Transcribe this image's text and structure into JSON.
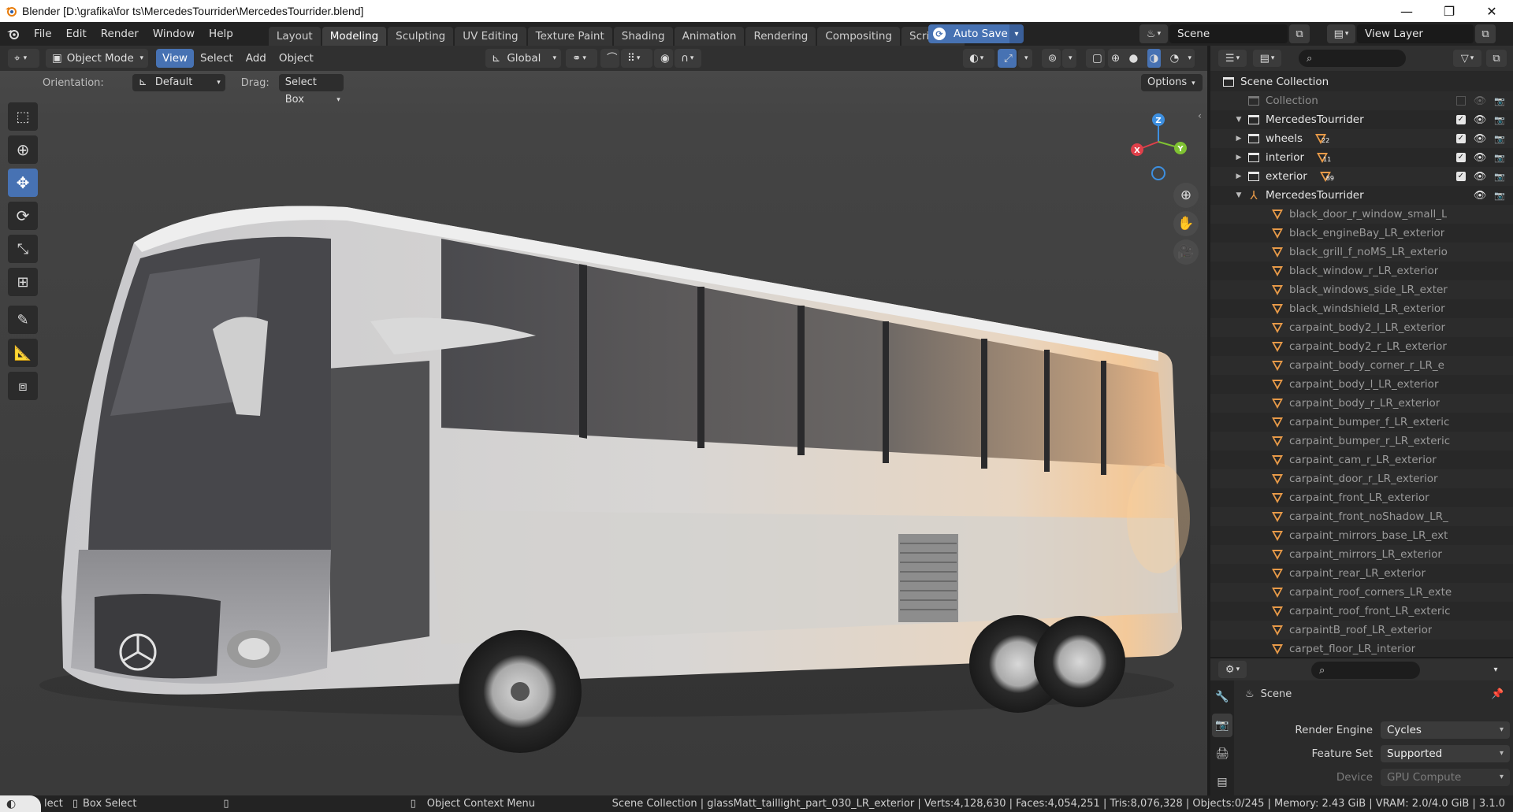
{
  "window": {
    "title": "Blender [D:\\grafika\\for ts\\MercedesTourrider\\MercedesTourrider.blend]",
    "minimize": "—",
    "maximize": "❐",
    "close": "✕"
  },
  "menu": [
    "File",
    "Edit",
    "Render",
    "Window",
    "Help"
  ],
  "workspaces": [
    {
      "label": "Layout",
      "active": false
    },
    {
      "label": "Modeling",
      "active": true
    },
    {
      "label": "Sculpting",
      "active": false
    },
    {
      "label": "UV Editing",
      "active": false
    },
    {
      "label": "Texture Paint",
      "active": false
    },
    {
      "label": "Shading",
      "active": false
    },
    {
      "label": "Animation",
      "active": false
    },
    {
      "label": "Rendering",
      "active": false
    },
    {
      "label": "Compositing",
      "active": false
    },
    {
      "label": "Scripting",
      "active": false
    }
  ],
  "workspace_add": "+",
  "auto_save": "Auto Save",
  "scene_name": "Scene",
  "view_layer": "View Layer",
  "viewport": {
    "mode": "Object Mode",
    "menus": [
      {
        "label": "View",
        "active": true
      },
      {
        "label": "Select",
        "active": false
      },
      {
        "label": "Add",
        "active": false
      },
      {
        "label": "Object",
        "active": false
      }
    ],
    "transform_orientation": "Global",
    "orientation_label": "Orientation:",
    "orientation_value": "Default",
    "drag_label": "Drag:",
    "drag_value": "Select Box",
    "options": "Options",
    "gizmo": {
      "x": "X",
      "y": "Y",
      "z": "Z"
    }
  },
  "outliner": {
    "rows": [
      {
        "label": "Scene Collection",
        "indent": 0,
        "type": "scene",
        "arrow": ""
      },
      {
        "label": "Collection",
        "indent": 1,
        "type": "collection-dim",
        "arrow": ""
      },
      {
        "label": "MercedesTourrider",
        "indent": 1,
        "type": "collection",
        "arrow": "▼"
      },
      {
        "label": "wheels",
        "indent": 2,
        "type": "collection",
        "arrow": "▶",
        "badge": "22"
      },
      {
        "label": "interior",
        "indent": 2,
        "type": "collection",
        "arrow": "▶",
        "badge": "11"
      },
      {
        "label": "exterior",
        "indent": 2,
        "type": "collection",
        "arrow": "▶",
        "badge": "89"
      },
      {
        "label": "MercedesTourrider",
        "indent": 2,
        "type": "armature",
        "arrow": "▼"
      },
      {
        "label": "black_door_r_window_small_L",
        "indent": 3,
        "type": "mesh"
      },
      {
        "label": "black_engineBay_LR_exterior",
        "indent": 3,
        "type": "mesh"
      },
      {
        "label": "black_grill_f_noMS_LR_exterio",
        "indent": 3,
        "type": "mesh"
      },
      {
        "label": "black_window_r_LR_exterior",
        "indent": 3,
        "type": "mesh"
      },
      {
        "label": "black_windows_side_LR_exter",
        "indent": 3,
        "type": "mesh"
      },
      {
        "label": "black_windshield_LR_exterior",
        "indent": 3,
        "type": "mesh"
      },
      {
        "label": "carpaint_body2_l_LR_exterior",
        "indent": 3,
        "type": "mesh"
      },
      {
        "label": "carpaint_body2_r_LR_exterior",
        "indent": 3,
        "type": "mesh"
      },
      {
        "label": "carpaint_body_corner_r_LR_e",
        "indent": 3,
        "type": "mesh"
      },
      {
        "label": "carpaint_body_l_LR_exterior",
        "indent": 3,
        "type": "mesh"
      },
      {
        "label": "carpaint_body_r_LR_exterior",
        "indent": 3,
        "type": "mesh"
      },
      {
        "label": "carpaint_bumper_f_LR_exteric",
        "indent": 3,
        "type": "mesh"
      },
      {
        "label": "carpaint_bumper_r_LR_exteric",
        "indent": 3,
        "type": "mesh"
      },
      {
        "label": "carpaint_cam_r_LR_exterior",
        "indent": 3,
        "type": "mesh"
      },
      {
        "label": "carpaint_door_r_LR_exterior",
        "indent": 3,
        "type": "mesh"
      },
      {
        "label": "carpaint_front_LR_exterior",
        "indent": 3,
        "type": "mesh"
      },
      {
        "label": "carpaint_front_noShadow_LR_",
        "indent": 3,
        "type": "mesh"
      },
      {
        "label": "carpaint_mirrors_base_LR_ext",
        "indent": 3,
        "type": "mesh"
      },
      {
        "label": "carpaint_mirrors_LR_exterior",
        "indent": 3,
        "type": "mesh"
      },
      {
        "label": "carpaint_rear_LR_exterior",
        "indent": 3,
        "type": "mesh"
      },
      {
        "label": "carpaint_roof_corners_LR_exte",
        "indent": 3,
        "type": "mesh"
      },
      {
        "label": "carpaint_roof_front_LR_exteric",
        "indent": 3,
        "type": "mesh"
      },
      {
        "label": "carpaintB_roof_LR_exterior",
        "indent": 3,
        "type": "mesh"
      },
      {
        "label": "carpet_floor_LR_interior",
        "indent": 3,
        "type": "mesh"
      }
    ]
  },
  "properties": {
    "context": "Scene",
    "render_engine_label": "Render Engine",
    "render_engine": "Cycles",
    "feature_set_label": "Feature Set",
    "feature_set": "Supported",
    "device_label": "Device",
    "device": "GPU Compute"
  },
  "statusbar": {
    "select": "lect",
    "box_select": "Box Select",
    "context_menu": "Object Context Menu",
    "stats": "Scene Collection | glassMatt_taillight_part_030_LR_exterior | Verts:4,128,630 | Faces:4,054,251 | Tris:8,076,328 | Objects:0/245 | Memory: 2.43 GiB | VRAM: 2.0/4.0 GiB | 3.1.0"
  },
  "colors": {
    "accent": "#4772b3",
    "mesh_icon": "#e89a48",
    "x_axis": "#e0404a",
    "y_axis": "#7fc232",
    "z_axis": "#3d8fe0"
  }
}
